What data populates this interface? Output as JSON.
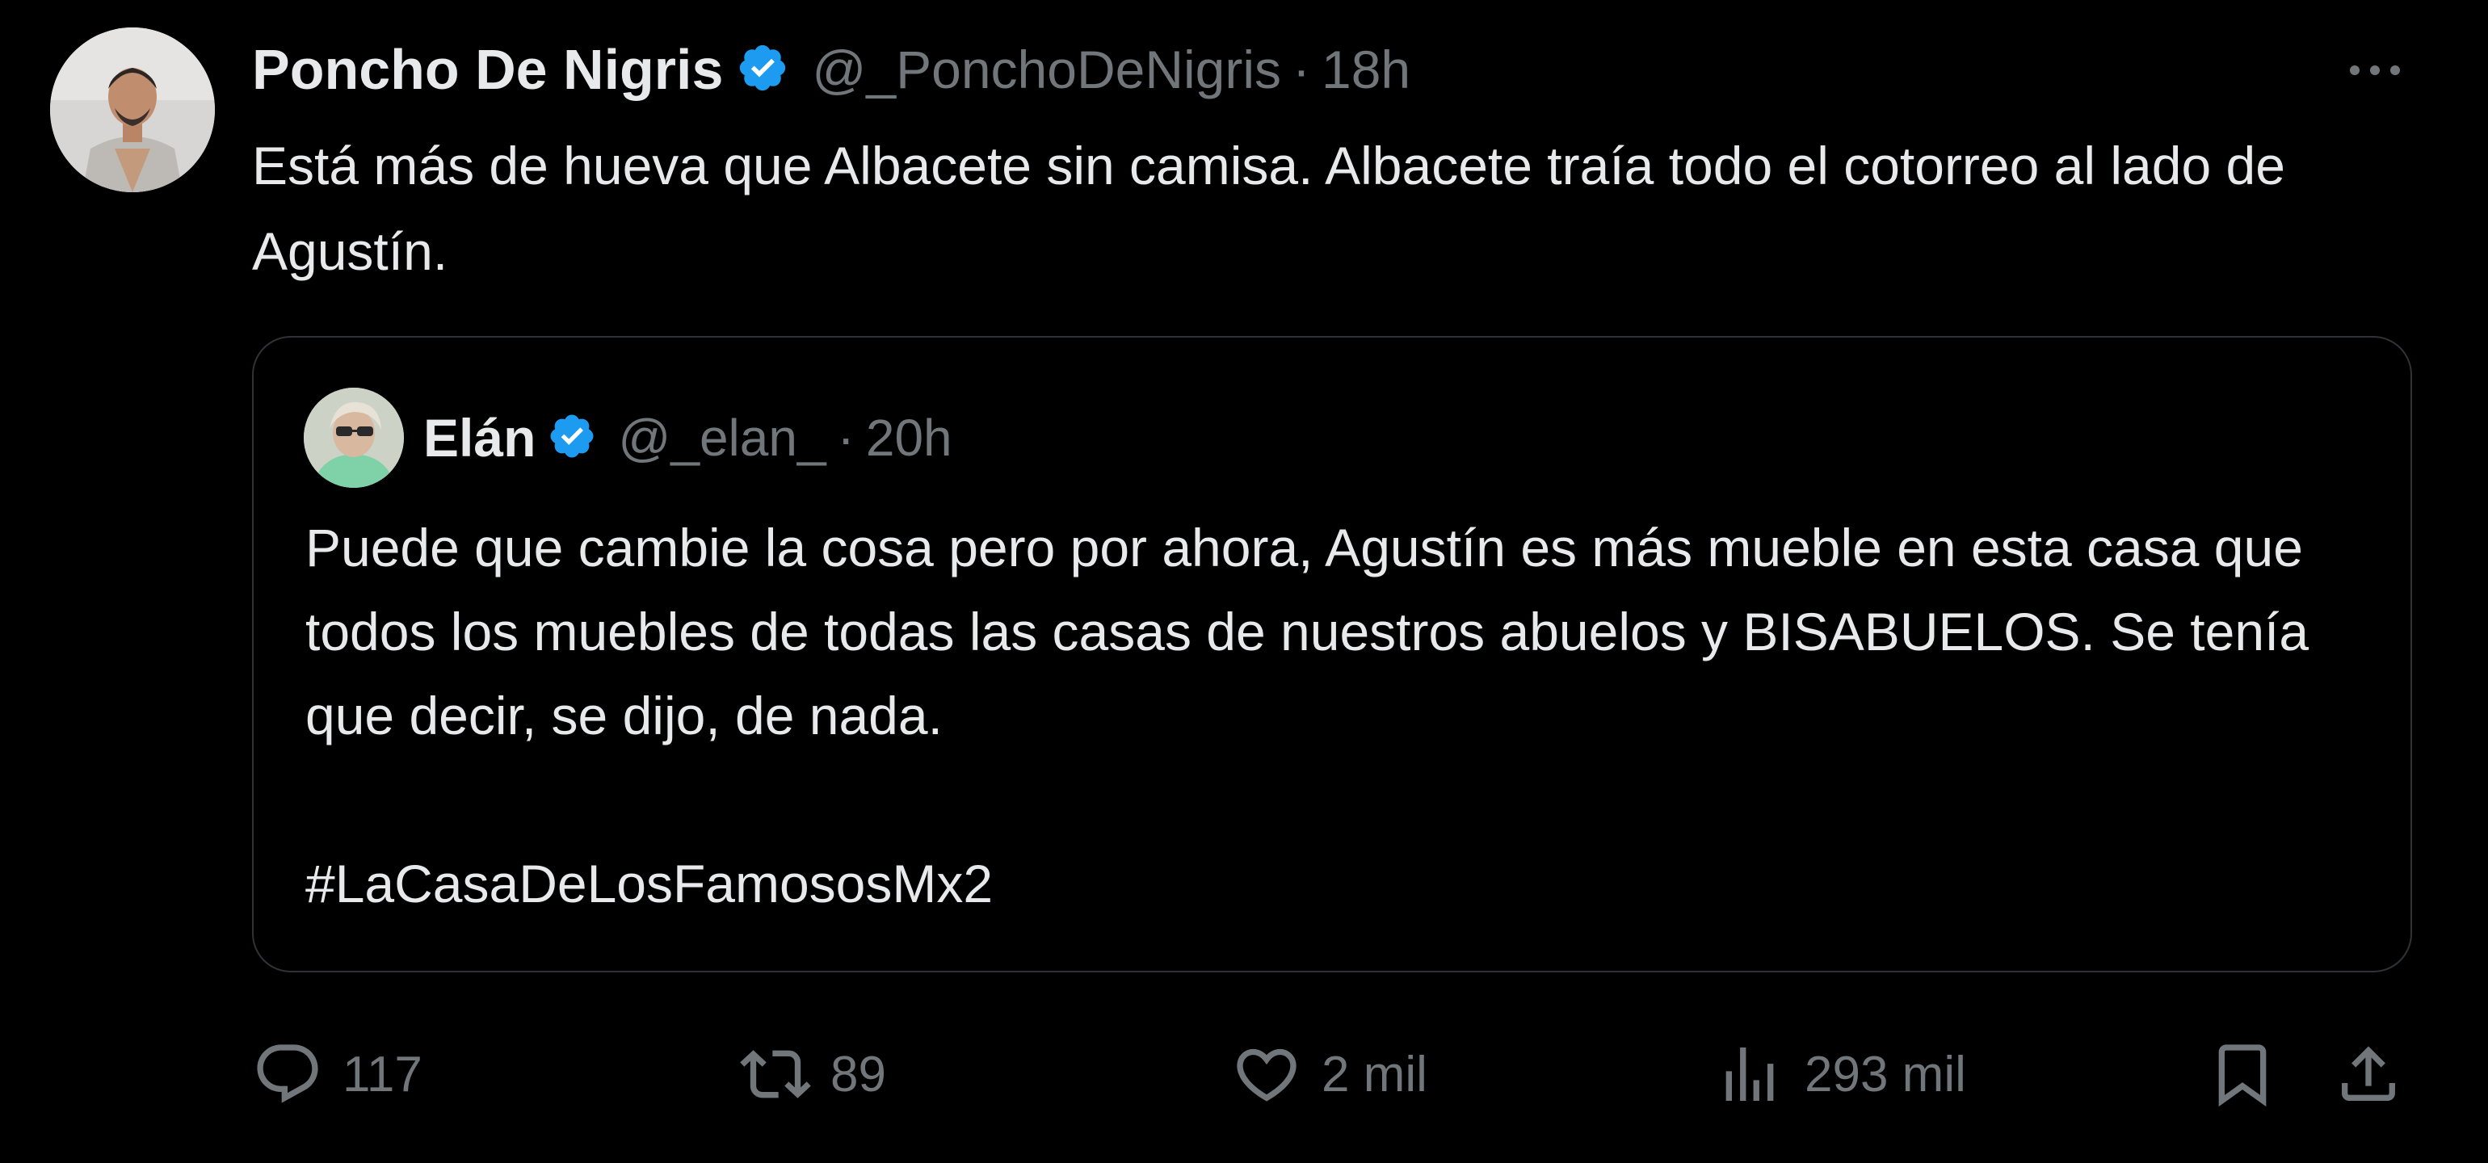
{
  "tweet": {
    "author_name": "Poncho De Nigris",
    "handle": "@_PonchoDeNigris",
    "separator": "·",
    "time": "18h",
    "text": "Está más de hueva que Albacete sin camisa. Albacete traía todo el cotorreo al lado de Agustín.",
    "more_icon": "more-horizontal-icon",
    "verified_icon": "verified-badge-icon"
  },
  "quote": {
    "author_name": "Elán",
    "handle": "@_elan_",
    "separator": "·",
    "time": "20h",
    "text": "Puede que cambie la cosa pero por ahora, Agustín es más mueble en esta casa que todos los muebles de todas las casas de nuestros abuelos y BISABUELOS. Se tenía que decir, se dijo, de nada.",
    "hashtag": "#LaCasaDeLosFamososMx2"
  },
  "actions": {
    "replies": "117",
    "retweets": "89",
    "likes": "2 mil",
    "views": "293 mil",
    "icons": [
      "reply-icon",
      "retweet-icon",
      "like-icon",
      "views-icon",
      "bookmark-icon",
      "share-icon"
    ]
  },
  "colors": {
    "background": "#000000",
    "text_primary": "#e7e9ea",
    "text_secondary": "#71767b",
    "border": "#2f3336",
    "verified": "#1d9bf0"
  }
}
